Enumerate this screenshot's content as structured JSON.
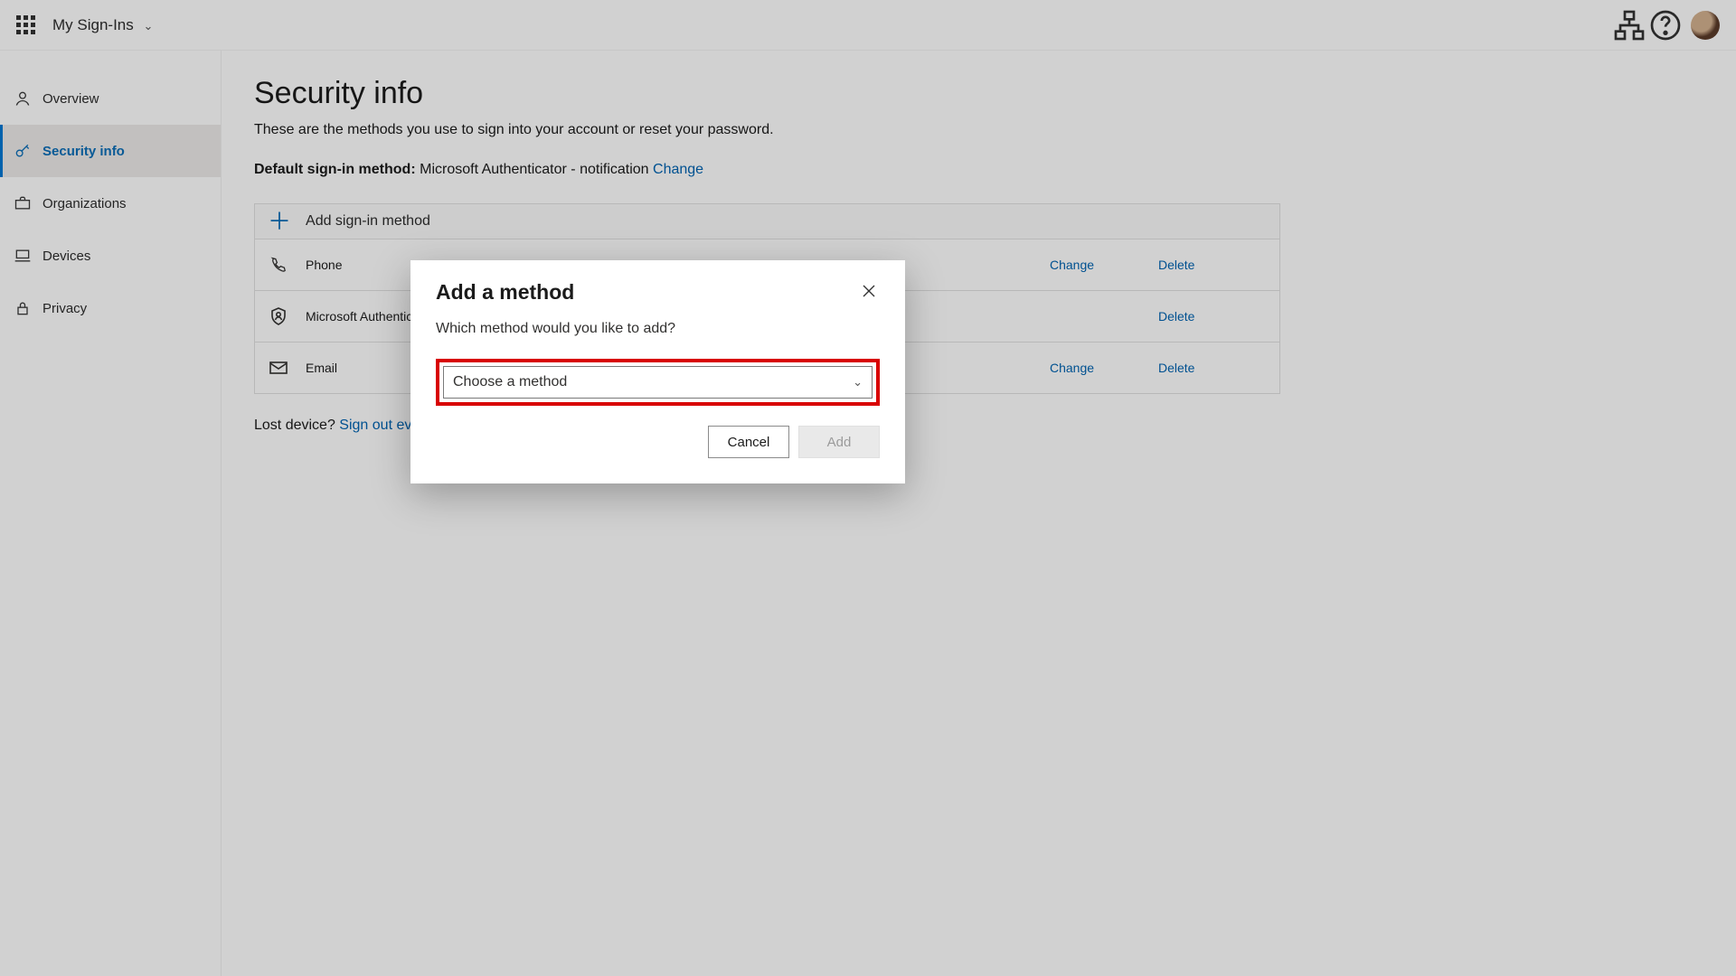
{
  "header": {
    "app_title": "My Sign-Ins"
  },
  "sidebar": {
    "items": [
      {
        "label": "Overview"
      },
      {
        "label": "Security info"
      },
      {
        "label": "Organizations"
      },
      {
        "label": "Devices"
      },
      {
        "label": "Privacy"
      }
    ]
  },
  "main": {
    "title": "Security info",
    "description": "These are the methods you use to sign into your account or reset your password.",
    "default_prefix": "Default sign-in method:",
    "default_value": "Microsoft Authenticator - notification",
    "change_label": "Change",
    "add_label": "Add sign-in method",
    "methods": [
      {
        "name": "Phone",
        "change": "Change",
        "delete": "Delete"
      },
      {
        "name": "Microsoft Authenticator",
        "change": "",
        "delete": "Delete"
      },
      {
        "name": "Email",
        "change": "Change",
        "delete": "Delete"
      }
    ],
    "lost_label": "Lost device?",
    "lost_action": "Sign out everywhere"
  },
  "dialog": {
    "title": "Add a method",
    "subtitle": "Which method would you like to add?",
    "combo_placeholder": "Choose a method",
    "cancel": "Cancel",
    "add": "Add"
  }
}
